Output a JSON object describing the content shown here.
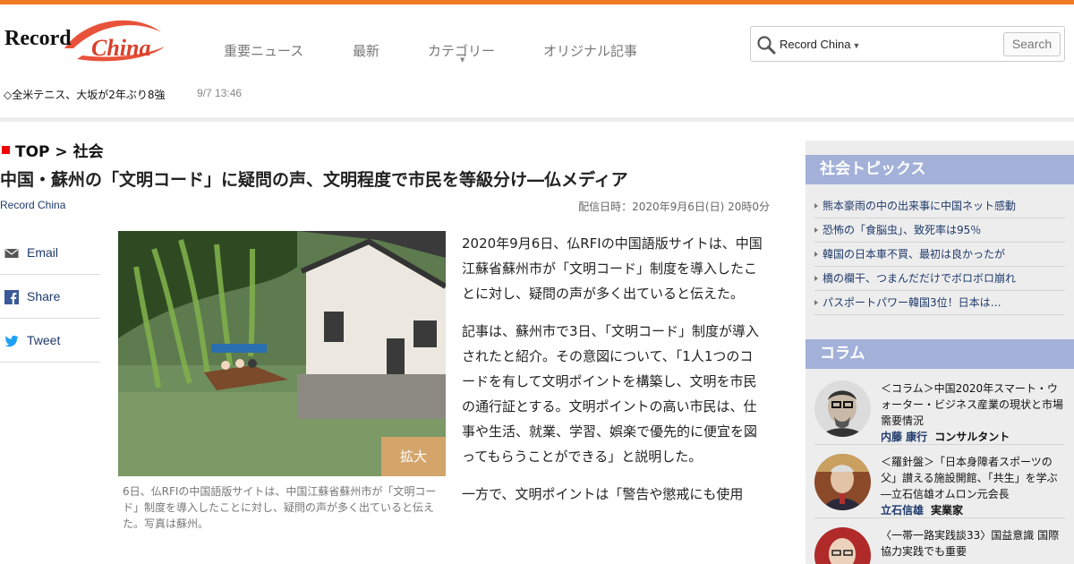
{
  "header": {
    "logo_text": "Record China",
    "nav": [
      "重要ニュース",
      "最新",
      "カテゴリー",
      "オリジナル記事"
    ],
    "search_scope": "Record China",
    "search_button": "Search"
  },
  "ticker": {
    "text": "◇全米テニス、大坂が2年ぶり8強",
    "time": "9/7 13:46"
  },
  "article": {
    "breadcrumb": "TOP > 社会",
    "title": "中国・蘇州の「文明コード」に疑問の声、文明程度で市民を等級分け―仏メディア",
    "source": "Record China",
    "date": "配信日時：2020年9月6日(日) 20時0分",
    "share": [
      "Email",
      "Share",
      "Tweet"
    ],
    "zoom_label": "拡大",
    "caption": "6日、仏RFIの中国語版サイトは、中国江蘇省蘇州市が「文明コード」制度を導入したことに対し、疑問の声が多く出ていると伝えた。写真は蘇州。",
    "paragraphs": [
      "2020年9月6日、仏RFIの中国語版サイトは、中国江蘇省蘇州市が「文明コード」制度を導入したことに対し、疑問の声が多く出ていると伝えた。",
      "記事は、蘇州市で3日、「文明コード」制度が導入されたと紹介。その意図について、「1人1つのコードを有して文明ポイントを構築し、文明を市民の通行証とする。文明ポイントの高い市民は、仕事や生活、就業、学習、娯楽で優先的に便宜を図ってもらうことができる」と説明した。",
      "一方で、文明ポイントは「警告や懲戒にも使用"
    ]
  },
  "sidebar": {
    "topics_title": "社会トピックス",
    "topics": [
      "熊本豪雨の中の出来事に中国ネット感動",
      "恐怖の「食脳虫」、致死率は95％",
      "韓国の日本車不買、最初は良かったが",
      "橋の欄干、つまんだだけでボロボロ崩れ",
      "パスポートパワー韓国3位！日本は…"
    ],
    "column_title": "コラム",
    "columns": [
      {
        "title": "＜コラム＞中国2020年スマート・ウォーター・ビジネス産業の現状と市場需要情況",
        "author": "内藤 康行",
        "role": "コンサルタント"
      },
      {
        "title": "＜羅針盤＞「日本身障者スポーツの父」讃える施設開館、「共生」を学ぶ―立石信雄オムロン元会長",
        "author": "立石信雄",
        "role": "実業家"
      },
      {
        "title": "〈一帯一路実践談33〉国益意識 国際協力実践でも重要",
        "author": "",
        "role": ""
      }
    ]
  },
  "colors": {
    "accent": "#f07a26",
    "sidebar_head": "#a3b1d9",
    "link": "#1f3a6b",
    "bullet": "#e00000"
  }
}
